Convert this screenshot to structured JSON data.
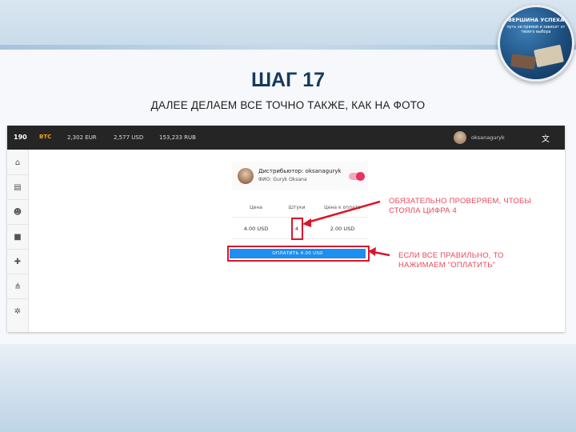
{
  "slide": {
    "title": "ШАГ 17",
    "subtitle": "ДАЛЕЕ ДЕЛАЕМ ВСЕ ТОЧНО ТАКЖЕ, КАК НА ФОТО"
  },
  "logo": {
    "line1": "ВЕРШИНА УСПЕХА",
    "line2": "путь не прямой и зависит от твоего выбора"
  },
  "topbar": {
    "brand": "190",
    "currency": "BTC",
    "rates": [
      "2,302 EUR",
      "2,577 USD",
      "153,233 RUB"
    ],
    "username": "oksanaguryk",
    "lang_icon": "translate-icon",
    "accent_color": "#f0a020"
  },
  "sidebar": {
    "items": [
      "home-icon",
      "wallet-icon",
      "team-icon",
      "briefcase-icon",
      "puzzle-icon",
      "structure-icon",
      "gear-icon"
    ]
  },
  "card": {
    "distributor_label": "Дистрибьютор: oksanaguryk",
    "distributor_name": "ФИО: Guryk Oksana",
    "toggle_on": true,
    "columns": [
      "Цена",
      "Штуки",
      "Цена к оплате"
    ],
    "row": [
      "4.00 USD",
      "4",
      "2.00 USD"
    ],
    "pay_button": "ОПЛАТИТЬ 4.00 USD",
    "pay_color": "#1e8ef0"
  },
  "annotations": {
    "note1_line1": "ОБЯЗАТЕЛЬНО ПРОВЕРЯЕМ, ЧТОБЫ",
    "note1_line2": "СТОЯЛА ЦИФРА 4",
    "note2_line1": "ЕСЛИ ВСЕ ПРАВИЛЬНО, ТО",
    "note2_line2": "НАЖИМАЕМ \"ОПЛАТИТЬ\"",
    "color": "#d9162a"
  }
}
